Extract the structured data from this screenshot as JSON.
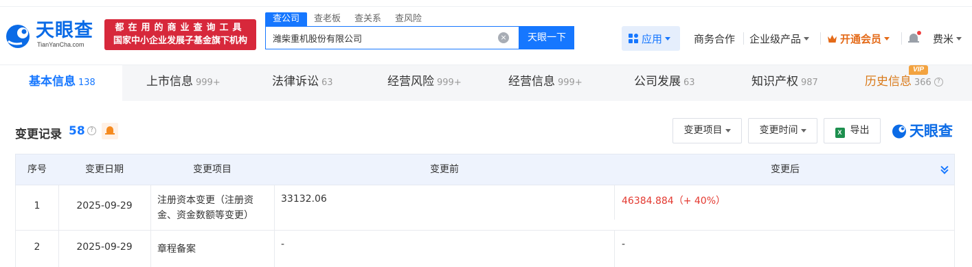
{
  "header": {
    "logo": {
      "name": "天眼查",
      "sub": "TianYanCha.com"
    },
    "banner": {
      "line1": "都在用的商业查询工具",
      "line2": "国家中小企业发展子基金旗下机构"
    },
    "search_tabs": [
      "查公司",
      "查老板",
      "查关系",
      "查风险"
    ],
    "search": {
      "value": "潍柴重机股份有限公司",
      "clear": "×",
      "button": "天眼一下"
    },
    "nav": {
      "app": "应用",
      "business": "商务合作",
      "enterprise": "企业级产品",
      "vip": "开通会员",
      "user": "费米"
    }
  },
  "tabs": [
    {
      "label": "基本信息",
      "count": "138"
    },
    {
      "label": "上市信息",
      "count": "999+"
    },
    {
      "label": "法律诉讼",
      "count": "63"
    },
    {
      "label": "经营风险",
      "count": "999+"
    },
    {
      "label": "经营信息",
      "count": "999+"
    },
    {
      "label": "公司发展",
      "count": "63"
    },
    {
      "label": "知识产权",
      "count": "987"
    },
    {
      "label": "历史信息",
      "count": "366",
      "badge": "VIP"
    }
  ],
  "section": {
    "title": "变更记录",
    "count": "58",
    "help": "?",
    "filter_item": "变更项目",
    "filter_time": "变更时间",
    "export": "导出",
    "xls": "X",
    "watermark": "天眼查"
  },
  "table": {
    "headers": [
      "序号",
      "变更日期",
      "变更项目",
      "变更前",
      "变更后"
    ],
    "rows": [
      {
        "index": "1",
        "date": "2025-09-29",
        "item": "注册资本变更（注册资金、资金数额等变更）",
        "before": "33132.06",
        "after": "46384.884（+ 40%）"
      },
      {
        "index": "2",
        "date": "2025-09-29",
        "item": "章程备案",
        "before": "-",
        "after": "-"
      }
    ]
  },
  "colors": {
    "brand": "#1677ff",
    "banner": "#d7283b",
    "vip": "#e46a18",
    "increase": "#e3382f"
  }
}
